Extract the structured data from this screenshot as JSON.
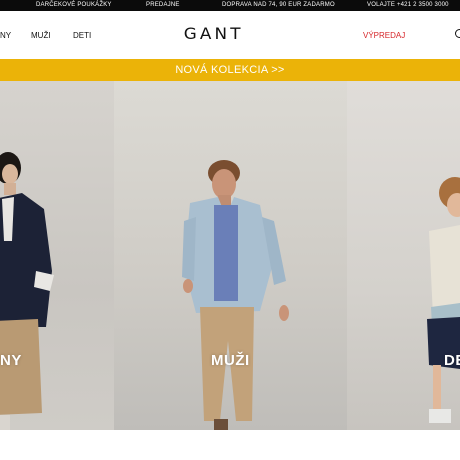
{
  "topbar": {
    "gift_cards": "DARČEKOVÉ POUKÁŽKY",
    "stores": "PREDAJNE",
    "shipping": "DOPRAVA NAD 74, 90 EUR ZADARMO",
    "phone": "VOLAJTE +421 2 3500 3000"
  },
  "nav": {
    "women": "NY",
    "men": "MUŽI",
    "kids": "DETI",
    "logo": "GANT",
    "sale": "VÝPREDAJ"
  },
  "banner": {
    "text": "NOVÁ KOLEKCIA >>"
  },
  "categories": {
    "women": "NY",
    "men": "MUŽI",
    "kids": "DE"
  },
  "colors": {
    "banner": "#ebb308",
    "sale": "#d6262a",
    "topbar": "#0b0b0b"
  },
  "icons": {
    "search": "search-icon"
  }
}
